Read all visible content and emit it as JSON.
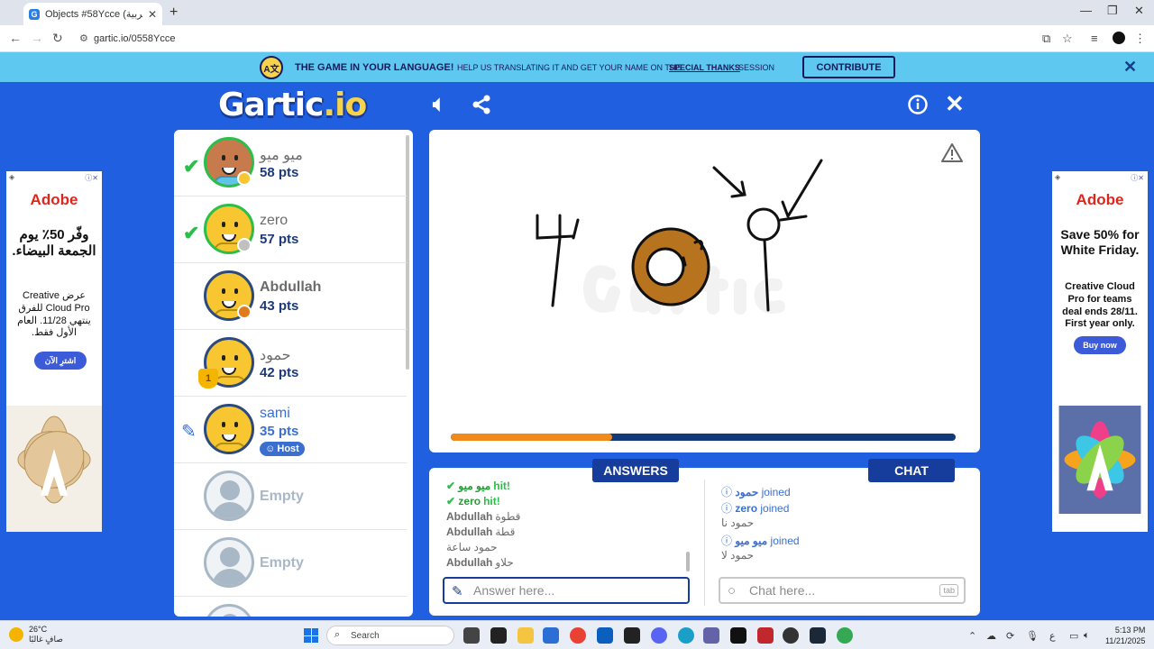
{
  "browser": {
    "tab_title": "Objects #58Ycce (العربية) - Gartic",
    "tab_favicon": "G",
    "url": "gartic.io/0558Ycce"
  },
  "banner": {
    "globe_text": "A文",
    "headline": "THE GAME IN YOUR LANGUAGE!",
    "text_before": "HELP US TRANSLATING IT AND GET YOUR NAME ON THE",
    "link": "SPECIAL THANKS",
    "text_after": "SESSION",
    "button": "CONTRIBUTE"
  },
  "logo": {
    "main": "Gartic",
    "suffix": ".io"
  },
  "players": [
    {
      "name": "ميو ميو",
      "pts": "58 pts",
      "guessed": true,
      "avatar": "brown",
      "dot": "#f7c630"
    },
    {
      "name": "zero",
      "pts": "57 pts",
      "guessed": true,
      "avatar": "yellow",
      "dot": "#c0c0c0"
    },
    {
      "name": "Abdullah",
      "pts": "43 pts",
      "guessed": false,
      "avatar": "yellow",
      "dot": "#e07a1a"
    },
    {
      "name": "حمود",
      "pts": "42 pts",
      "guessed": false,
      "avatar": "yellow",
      "trophy": "1"
    },
    {
      "name": "sami",
      "pts": "35 pts",
      "drawing": true,
      "host": "Host",
      "avatar": "yellow"
    },
    {
      "name": "Empty"
    },
    {
      "name": "Empty"
    }
  ],
  "round": {
    "progress": 0.32
  },
  "tabs": {
    "answers": "ANSWERS",
    "chat": "CHAT"
  },
  "answers": [
    {
      "who": "ميو ميو",
      "text": "hit!",
      "hit": true
    },
    {
      "who": "zero",
      "text": "hit!",
      "hit": true
    },
    {
      "who": "Abdullah",
      "text": "قطوة"
    },
    {
      "who": "Abdullah",
      "text": "قطة"
    },
    {
      "who": "",
      "text": "حمود ساعة"
    },
    {
      "who": "Abdullah",
      "text": "حلاو"
    }
  ],
  "chat": [
    {
      "who": "حمود",
      "text": "joined",
      "sys": true
    },
    {
      "who": "zero",
      "text": "joined",
      "sys": true
    },
    {
      "who": "",
      "text": "حمود نا"
    },
    {
      "who": "ميو ميو",
      "text": "joined",
      "sys": true
    },
    {
      "who": "",
      "text": "حمود لا"
    }
  ],
  "inputs": {
    "answer_placeholder": "Answer here...",
    "chat_placeholder": "Chat here...",
    "tab_hint": "tab"
  },
  "ads": {
    "left": {
      "brand": "Adobe",
      "headline": "وفّر 50٪ يوم الجمعة البيضاء.",
      "body": "عرض Creative Cloud Pro للفرق ينتهي 11/28. العام الأول فقط.",
      "button": "اشترِ الآن"
    },
    "right": {
      "brand": "Adobe",
      "headline": "Save 50% for White Friday.",
      "body": "Creative Cloud Pro for teams deal ends 28/11. First year only.",
      "button": "Buy now"
    }
  },
  "taskbar": {
    "temp": "26°C",
    "weather": "صافٍ غالبًا",
    "search": "Search",
    "lang": "ع",
    "time": "5:13 PM",
    "date": "11/21/2025"
  }
}
